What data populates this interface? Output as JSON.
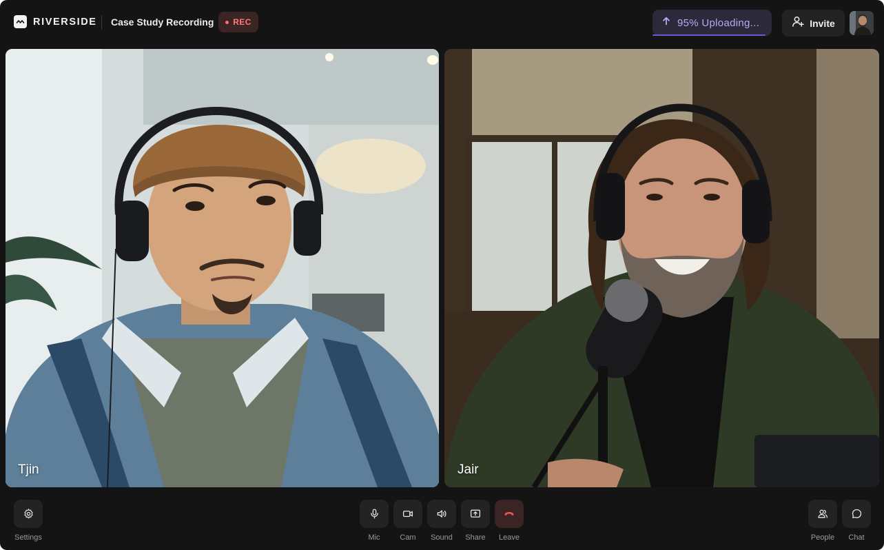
{
  "app": {
    "brand": "RIVERSIDE",
    "project_title": "Case Study Recording",
    "recording_badge": "REC",
    "colors": {
      "background": "#141414",
      "accent": "#6c5bd6",
      "rec": "#ff6b6b",
      "leave": "#ef5a5a"
    }
  },
  "header": {
    "upload_status": "95% Uploading...",
    "upload_progress": 0.95,
    "invite_label": "Invite",
    "avatar_icon": "user-avatar"
  },
  "participants": [
    {
      "name": "Tjin"
    },
    {
      "name": "Jair"
    }
  ],
  "controls": {
    "settings": "Settings",
    "mic": "Mic",
    "cam": "Cam",
    "sound": "Sound",
    "share": "Share",
    "leave": "Leave",
    "people": "People",
    "chat": "Chat"
  }
}
